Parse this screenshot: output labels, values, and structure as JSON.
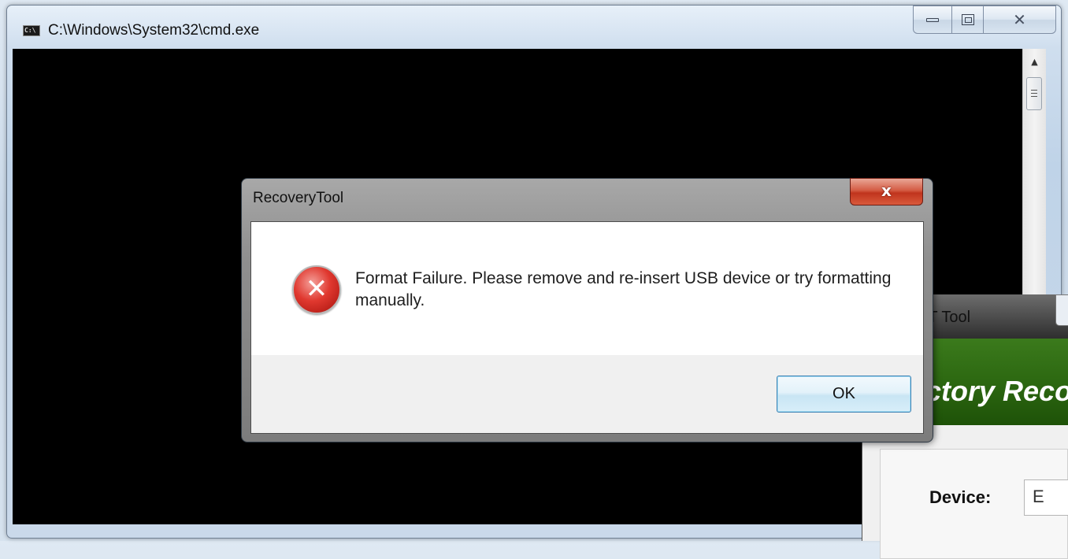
{
  "cmd_window": {
    "icon_text": "C:\\",
    "title": "C:\\Windows\\System32\\cmd.exe",
    "caption_buttons": {
      "minimize_icon": "minimize-icon",
      "maximize_icon": "maximize-icon",
      "close_glyph": "✕"
    }
  },
  "tool_window": {
    "title": "ET Tool",
    "banner": "ctory Reco",
    "device_label": "Device:",
    "device_value": "E"
  },
  "dialog": {
    "title": "RecoveryTool",
    "close_glyph": "x",
    "message": "Format Failure. Please remove and re-insert USB device or try formatting manually.",
    "icon": "error-icon",
    "icon_glyph": "✕",
    "ok_label": "OK"
  }
}
